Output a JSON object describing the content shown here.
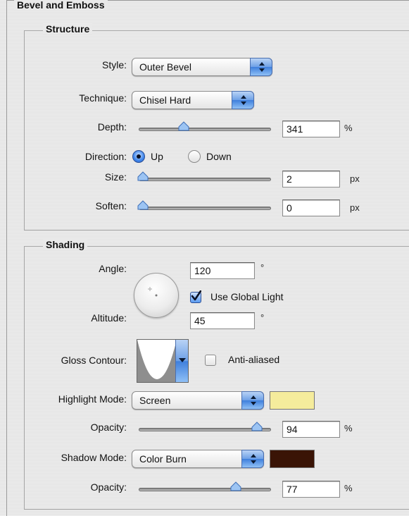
{
  "bevel_title": "Bevel and Emboss",
  "structure": {
    "title": "Structure",
    "style_label": "Style:",
    "style_value": "Outer Bevel",
    "technique_label": "Technique:",
    "technique_value": "Chisel Hard",
    "depth_label": "Depth:",
    "depth_value": "341",
    "depth_unit": "%",
    "direction_label": "Direction:",
    "direction_up": "Up",
    "direction_down": "Down",
    "direction_selected": "Up",
    "size_label": "Size:",
    "size_value": "2",
    "size_unit": "px",
    "soften_label": "Soften:",
    "soften_value": "0",
    "soften_unit": "px"
  },
  "shading": {
    "title": "Shading",
    "angle_label": "Angle:",
    "angle_value": "120",
    "angle_unit": "°",
    "use_global_light_label": "Use Global Light",
    "use_global_light_checked": true,
    "altitude_label": "Altitude:",
    "altitude_value": "45",
    "altitude_unit": "°",
    "gloss_contour_label": "Gloss Contour:",
    "anti_aliased_label": "Anti-aliased",
    "anti_aliased_checked": false,
    "highlight_mode_label": "Highlight Mode:",
    "highlight_mode_value": "Screen",
    "highlight_color": "#f5ec9c",
    "highlight_opacity_label": "Opacity:",
    "highlight_opacity_value": "94",
    "highlight_opacity_unit": "%",
    "shadow_mode_label": "Shadow Mode:",
    "shadow_mode_value": "Color Burn",
    "shadow_color": "#3a1406",
    "shadow_opacity_label": "Opacity:",
    "shadow_opacity_value": "77",
    "shadow_opacity_unit": "%"
  },
  "slider_levels": {
    "depth": 0.34,
    "size": 0.0,
    "soften": 0.0,
    "highlight_opacity": 0.94,
    "shadow_opacity": 0.77
  },
  "icons": {
    "popup_arrows": "up-down-arrows-icon",
    "slider_thumb": "slider-thumb-icon",
    "angle_dial": "angle-dial-icon",
    "contour_preview": "contour-curve-icon",
    "checkbox_check": "checkmark-icon"
  }
}
